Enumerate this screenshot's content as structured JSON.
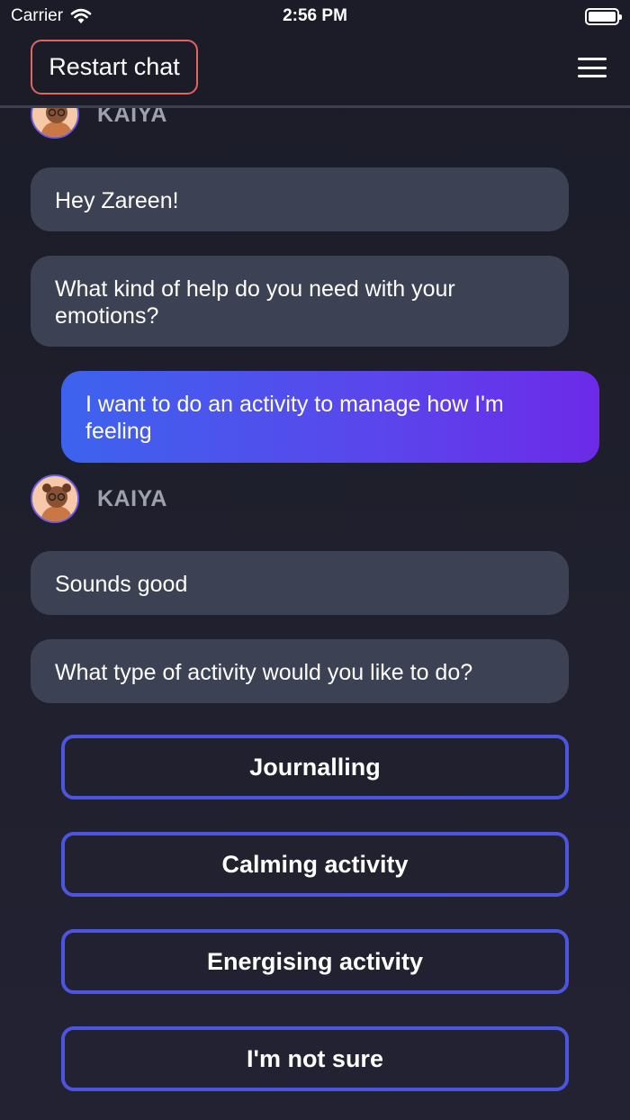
{
  "status_bar": {
    "carrier": "Carrier",
    "time": "2:56 PM"
  },
  "header": {
    "restart_label": "Restart chat"
  },
  "chat": {
    "sender_name": "KAIYA",
    "messages": [
      "Hey Zareen!",
      "What kind of help do you need with your emotions?",
      "I want to do an activity to manage how I'm feeling",
      "Sounds good",
      "What type of activity would you like to do?"
    ]
  },
  "options": [
    "Journalling",
    "Calming activity",
    "Energising activity",
    "I'm not sure"
  ],
  "colors": {
    "background": "#1b1c28",
    "bot_bubble": "#3c4154",
    "user_bubble_start": "#3d63ee",
    "user_bubble_end": "#6c2ae8",
    "restart_border": "#e0655f",
    "option_border": "#4d55e0"
  }
}
